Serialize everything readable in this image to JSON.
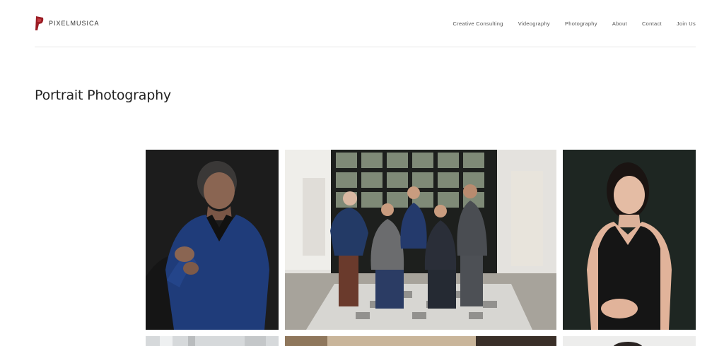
{
  "brand": {
    "name": "PIXELMUSICA",
    "accent": "#9b1c24"
  },
  "nav": {
    "items": [
      {
        "label": "Creative Consulting"
      },
      {
        "label": "Videography"
      },
      {
        "label": "Photography"
      },
      {
        "label": "About"
      },
      {
        "label": "Contact"
      },
      {
        "label": "Join Us"
      }
    ]
  },
  "page": {
    "title": "Portrait Photography"
  },
  "gallery": {
    "items": [
      {
        "subject": "man-blue-suit-portrait"
      },
      {
        "subject": "group-business-portrait"
      },
      {
        "subject": "woman-black-dress-portrait"
      },
      {
        "subject": "office-interior-photo"
      },
      {
        "subject": "interior-photo"
      },
      {
        "subject": "portrait-photo"
      }
    ]
  }
}
